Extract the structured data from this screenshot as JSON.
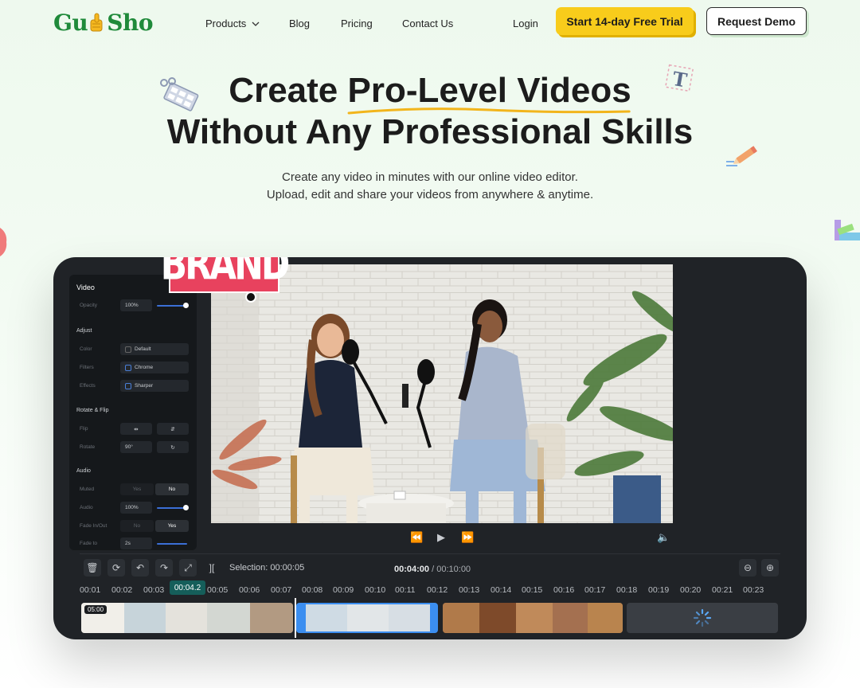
{
  "nav": {
    "logo_left": "Gu",
    "logo_right": "Sho",
    "products": "Products",
    "blog": "Blog",
    "pricing": "Pricing",
    "contact": "Contact Us",
    "login": "Login",
    "trial_button": "Start 14-day Free Trial",
    "demo_button": "Request Demo"
  },
  "hero": {
    "title_line1_a": "Create ",
    "title_line1_b": "Pro-Level Videos",
    "title_line2": "Without Any Professional Skills",
    "subtitle_line1": "Create any video in minutes with our online video editor.",
    "subtitle_line2": "Upload, edit and share your videos from anywhere & anytime."
  },
  "editor": {
    "brand_badge": "BRAND",
    "panel": {
      "video_title": "Video",
      "opacity_label": "Opacity",
      "opacity_value": "100%",
      "adjust_title": "Adjust",
      "color_label": "Color",
      "color_value": "Default",
      "filters_label": "Filters",
      "filters_value": "Chrome",
      "effects_label": "Effects",
      "effects_value": "Sharper",
      "rotate_title": "Rotate & Flip",
      "flip_label": "Flip",
      "rotate_label": "Rotate",
      "rotate_value": "90°",
      "audio_title": "Audio",
      "muted_label": "Muted",
      "muted_yes": "Yes",
      "muted_no": "No",
      "audio_label": "Audio",
      "audio_value": "100%",
      "fadein_label": "Fade In/Out",
      "fadein_no": "No",
      "fadein_yes": "Yes",
      "fadeto_label": "Fade to",
      "fadeto_value": "2s"
    },
    "selection": "Selection: 00:00:05",
    "current_time": "00:04:00",
    "separator": "/",
    "total_time": "00:10:00",
    "playhead_label": "00:04.2",
    "clip_duration": "05:00",
    "ruler": [
      "00:01",
      "00:02",
      "00:03",
      "00:05",
      "00:06",
      "00:07",
      "00:08",
      "00:09",
      "00:10",
      "00:11",
      "00:12",
      "00:13",
      "00:14",
      "00:15",
      "00:16",
      "00:17",
      "00:18",
      "00:19",
      "00:20",
      "00:21",
      "00:23"
    ]
  },
  "colors": {
    "accent_yellow": "#f8cc1b",
    "brand_green": "#1f8a3a",
    "brand_pink": "#e8425e",
    "editor_bg": "#202327",
    "selection_blue": "#3b8ef0"
  }
}
